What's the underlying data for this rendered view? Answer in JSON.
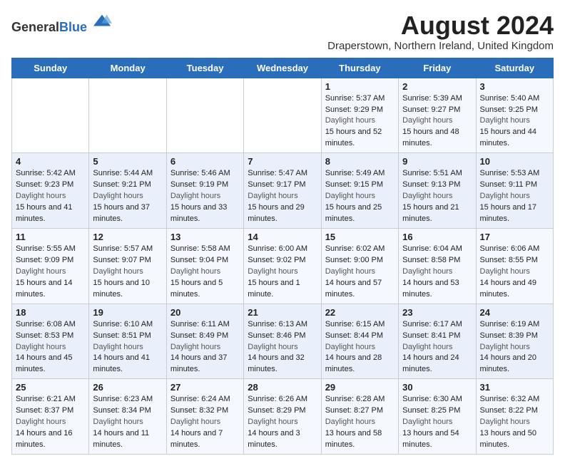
{
  "header": {
    "logo_general": "General",
    "logo_blue": "Blue",
    "month_year": "August 2024",
    "location": "Draperstown, Northern Ireland, United Kingdom"
  },
  "weekdays": [
    "Sunday",
    "Monday",
    "Tuesday",
    "Wednesday",
    "Thursday",
    "Friday",
    "Saturday"
  ],
  "weeks": [
    [
      {
        "day": "",
        "sunrise": "",
        "sunset": "",
        "daylight": ""
      },
      {
        "day": "",
        "sunrise": "",
        "sunset": "",
        "daylight": ""
      },
      {
        "day": "",
        "sunrise": "",
        "sunset": "",
        "daylight": ""
      },
      {
        "day": "",
        "sunrise": "",
        "sunset": "",
        "daylight": ""
      },
      {
        "day": "1",
        "sunrise": "5:37 AM",
        "sunset": "9:29 PM",
        "daylight": "15 hours and 52 minutes."
      },
      {
        "day": "2",
        "sunrise": "5:39 AM",
        "sunset": "9:27 PM",
        "daylight": "15 hours and 48 minutes."
      },
      {
        "day": "3",
        "sunrise": "5:40 AM",
        "sunset": "9:25 PM",
        "daylight": "15 hours and 44 minutes."
      }
    ],
    [
      {
        "day": "4",
        "sunrise": "5:42 AM",
        "sunset": "9:23 PM",
        "daylight": "15 hours and 41 minutes."
      },
      {
        "day": "5",
        "sunrise": "5:44 AM",
        "sunset": "9:21 PM",
        "daylight": "15 hours and 37 minutes."
      },
      {
        "day": "6",
        "sunrise": "5:46 AM",
        "sunset": "9:19 PM",
        "daylight": "15 hours and 33 minutes."
      },
      {
        "day": "7",
        "sunrise": "5:47 AM",
        "sunset": "9:17 PM",
        "daylight": "15 hours and 29 minutes."
      },
      {
        "day": "8",
        "sunrise": "5:49 AM",
        "sunset": "9:15 PM",
        "daylight": "15 hours and 25 minutes."
      },
      {
        "day": "9",
        "sunrise": "5:51 AM",
        "sunset": "9:13 PM",
        "daylight": "15 hours and 21 minutes."
      },
      {
        "day": "10",
        "sunrise": "5:53 AM",
        "sunset": "9:11 PM",
        "daylight": "15 hours and 17 minutes."
      }
    ],
    [
      {
        "day": "11",
        "sunrise": "5:55 AM",
        "sunset": "9:09 PM",
        "daylight": "15 hours and 14 minutes."
      },
      {
        "day": "12",
        "sunrise": "5:57 AM",
        "sunset": "9:07 PM",
        "daylight": "15 hours and 10 minutes."
      },
      {
        "day": "13",
        "sunrise": "5:58 AM",
        "sunset": "9:04 PM",
        "daylight": "15 hours and 5 minutes."
      },
      {
        "day": "14",
        "sunrise": "6:00 AM",
        "sunset": "9:02 PM",
        "daylight": "15 hours and 1 minute."
      },
      {
        "day": "15",
        "sunrise": "6:02 AM",
        "sunset": "9:00 PM",
        "daylight": "14 hours and 57 minutes."
      },
      {
        "day": "16",
        "sunrise": "6:04 AM",
        "sunset": "8:58 PM",
        "daylight": "14 hours and 53 minutes."
      },
      {
        "day": "17",
        "sunrise": "6:06 AM",
        "sunset": "8:55 PM",
        "daylight": "14 hours and 49 minutes."
      }
    ],
    [
      {
        "day": "18",
        "sunrise": "6:08 AM",
        "sunset": "8:53 PM",
        "daylight": "14 hours and 45 minutes."
      },
      {
        "day": "19",
        "sunrise": "6:10 AM",
        "sunset": "8:51 PM",
        "daylight": "14 hours and 41 minutes."
      },
      {
        "day": "20",
        "sunrise": "6:11 AM",
        "sunset": "8:49 PM",
        "daylight": "14 hours and 37 minutes."
      },
      {
        "day": "21",
        "sunrise": "6:13 AM",
        "sunset": "8:46 PM",
        "daylight": "14 hours and 32 minutes."
      },
      {
        "day": "22",
        "sunrise": "6:15 AM",
        "sunset": "8:44 PM",
        "daylight": "14 hours and 28 minutes."
      },
      {
        "day": "23",
        "sunrise": "6:17 AM",
        "sunset": "8:41 PM",
        "daylight": "14 hours and 24 minutes."
      },
      {
        "day": "24",
        "sunrise": "6:19 AM",
        "sunset": "8:39 PM",
        "daylight": "14 hours and 20 minutes."
      }
    ],
    [
      {
        "day": "25",
        "sunrise": "6:21 AM",
        "sunset": "8:37 PM",
        "daylight": "14 hours and 16 minutes."
      },
      {
        "day": "26",
        "sunrise": "6:23 AM",
        "sunset": "8:34 PM",
        "daylight": "14 hours and 11 minutes."
      },
      {
        "day": "27",
        "sunrise": "6:24 AM",
        "sunset": "8:32 PM",
        "daylight": "14 hours and 7 minutes."
      },
      {
        "day": "28",
        "sunrise": "6:26 AM",
        "sunset": "8:29 PM",
        "daylight": "14 hours and 3 minutes."
      },
      {
        "day": "29",
        "sunrise": "6:28 AM",
        "sunset": "8:27 PM",
        "daylight": "13 hours and 58 minutes."
      },
      {
        "day": "30",
        "sunrise": "6:30 AM",
        "sunset": "8:25 PM",
        "daylight": "13 hours and 54 minutes."
      },
      {
        "day": "31",
        "sunrise": "6:32 AM",
        "sunset": "8:22 PM",
        "daylight": "13 hours and 50 minutes."
      }
    ]
  ],
  "labels": {
    "sunrise": "Sunrise:",
    "sunset": "Sunset:",
    "daylight": "Daylight hours"
  }
}
